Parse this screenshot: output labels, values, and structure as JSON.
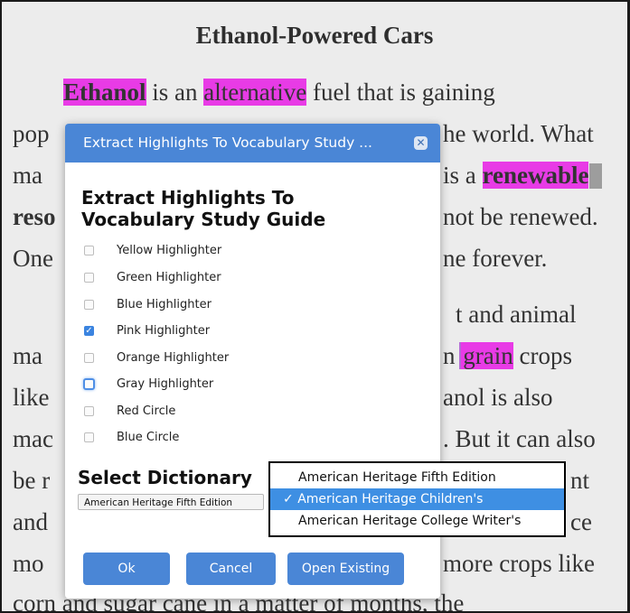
{
  "document": {
    "title": "Ethanol-Powered Cars",
    "paragraph_lines": [
      {
        "parts": [
          "Ethanol",
          " is an ",
          "alternative",
          " fuel that is gaining"
        ]
      },
      {
        "left": "pop",
        "right": "he world. What"
      },
      {
        "left": "ma",
        "right_plain": "is a ",
        "right_hl": "renewable"
      },
      {
        "left": "reso",
        "right": "not be renewed."
      },
      {
        "left": "One",
        "right": "ne forever."
      },
      {
        "right": "t and animal"
      },
      {
        "left": "ma",
        "right_pre": "n ",
        "right_hl": "grain",
        "right_post": " crops"
      },
      {
        "left": "like",
        "right": "anol is also"
      },
      {
        "left": "mac",
        "right": ". But it can also"
      },
      {
        "left": "be r",
        "right": "nt"
      },
      {
        "left": "and",
        "right": "ce"
      },
      {
        "left": "mo",
        "right": "more crops like"
      },
      {
        "text": "corn and sugar cane in a matter of months, the"
      }
    ]
  },
  "modal": {
    "header_title": "Extract Highlights To Vocabulary Study ...",
    "close_label": "✕",
    "heading": "Extract Highlights To Vocabulary Study Guide",
    "options": [
      {
        "label": "Yellow Highlighter",
        "checked": false
      },
      {
        "label": "Green Highlighter",
        "checked": false
      },
      {
        "label": "Blue Highlighter",
        "checked": false
      },
      {
        "label": "Pink Highlighter",
        "checked": true
      },
      {
        "label": "Orange Highlighter",
        "checked": false
      },
      {
        "label": "Gray Highlighter",
        "checked": false,
        "focused": true
      },
      {
        "label": "Red Circle",
        "checked": false
      },
      {
        "label": "Blue Circle",
        "checked": false
      }
    ],
    "dictionary_heading": "Select Dictionary",
    "dictionary_value": "American Heritage Fifth Edition",
    "buttons": {
      "ok": "Ok",
      "cancel": "Cancel",
      "open_existing": "Open Existing"
    }
  },
  "dropdown": {
    "items": [
      {
        "label": "American Heritage Fifth Edition",
        "selected": false
      },
      {
        "label": "American Heritage Children's",
        "selected": true
      },
      {
        "label": "American Heritage College Writer's",
        "selected": false
      }
    ],
    "check_mark": "✓"
  },
  "colors": {
    "highlight_pink": "#e83be6",
    "accent_blue": "#4a86d6",
    "dropdown_selected": "#3e8fe3"
  }
}
